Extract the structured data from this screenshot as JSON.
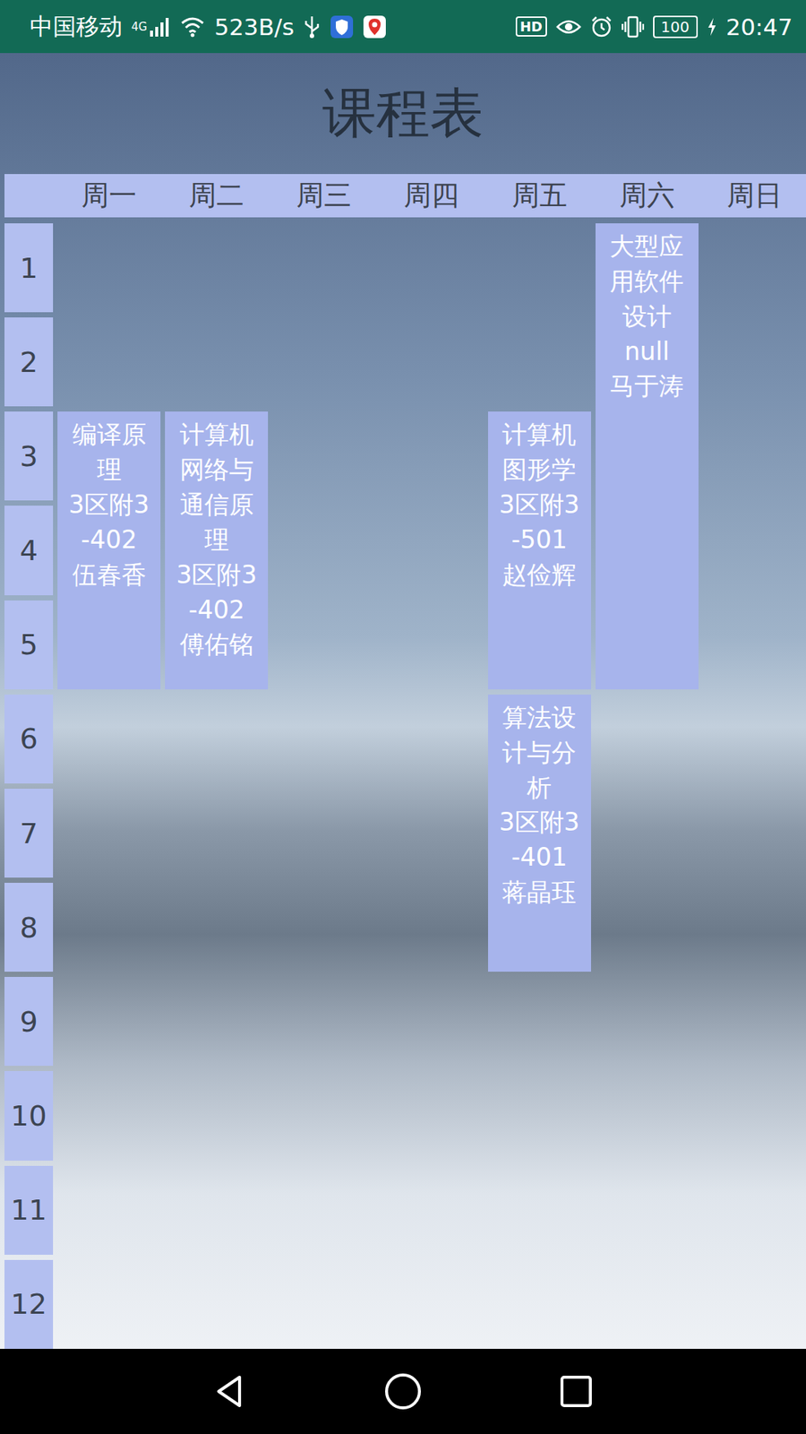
{
  "status_bar": {
    "carrier": "中国移动",
    "network": "4G",
    "speed": "523B/s",
    "hd": "HD",
    "battery": "100",
    "time": "20:47"
  },
  "title": "课程表",
  "days": [
    "周一",
    "周二",
    "周三",
    "周四",
    "周五",
    "周六",
    "周日"
  ],
  "periods": [
    "1",
    "2",
    "3",
    "4",
    "5",
    "6",
    "7",
    "8",
    "9",
    "10",
    "11",
    "12"
  ],
  "courses": [
    {
      "name": "编译原理",
      "room": "3区附3-402",
      "teacher": "伍春香",
      "day": "周一",
      "start": "3",
      "end": "5"
    },
    {
      "name": "计算机网络与通信原理",
      "room": "3区附3-402",
      "teacher": "傅佑铭",
      "day": "周二",
      "start": "3",
      "end": "5"
    },
    {
      "name": "计算机图形学",
      "room": "3区附3-501",
      "teacher": "赵俭辉",
      "day": "周五",
      "start": "3",
      "end": "5"
    },
    {
      "name": "算法设计与分析",
      "room": "3区附3-401",
      "teacher": "蒋晶珏",
      "day": "周五",
      "start": "6",
      "end": "8"
    },
    {
      "name": "大型应用软件设计",
      "room": "null",
      "teacher": "马于涛",
      "day": "周六",
      "start": "1",
      "end": "5"
    }
  ]
}
